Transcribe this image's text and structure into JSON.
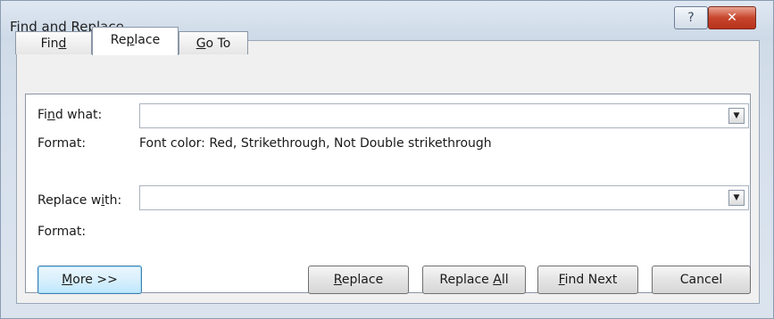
{
  "window": {
    "title": "Find and Replace",
    "help_glyph": "?",
    "close_glyph": "✕"
  },
  "tabs": [
    {
      "label": "Find",
      "mnemonic_pre": "Fin",
      "mnemonic": "d",
      "mnemonic_post": "",
      "selected": false
    },
    {
      "label": "Replace",
      "mnemonic_pre": "Re",
      "mnemonic": "p",
      "mnemonic_post": "lace",
      "selected": true
    },
    {
      "label": "Go To",
      "mnemonic_pre": "",
      "mnemonic": "G",
      "mnemonic_post": "o To",
      "selected": false
    }
  ],
  "find": {
    "label_pre": "Fi",
    "label_mnemonic": "n",
    "label_post": "d what:",
    "value": "",
    "format_label": "Format:",
    "format_value": "Font color: Red, Strikethrough, Not Double strikethrough"
  },
  "replace": {
    "label_pre": "Replace w",
    "label_mnemonic": "i",
    "label_post": "th:",
    "value": "",
    "format_label": "Format:",
    "format_value": ""
  },
  "dropdown_glyph": "▼",
  "buttons": {
    "more": {
      "pre": "",
      "mnemonic": "M",
      "post": "ore >>"
    },
    "replace": {
      "pre": "",
      "mnemonic": "R",
      "post": "eplace"
    },
    "replace_all": {
      "pre": "Replace ",
      "mnemonic": "A",
      "post": "ll"
    },
    "find_next": {
      "pre": "",
      "mnemonic": "F",
      "post": "ind Next"
    },
    "cancel": {
      "label": "Cancel"
    }
  },
  "colors": {
    "title_bg": "#cdd9e7",
    "close_red": "#c8452d",
    "default_button_border": "#3c7fb1"
  }
}
